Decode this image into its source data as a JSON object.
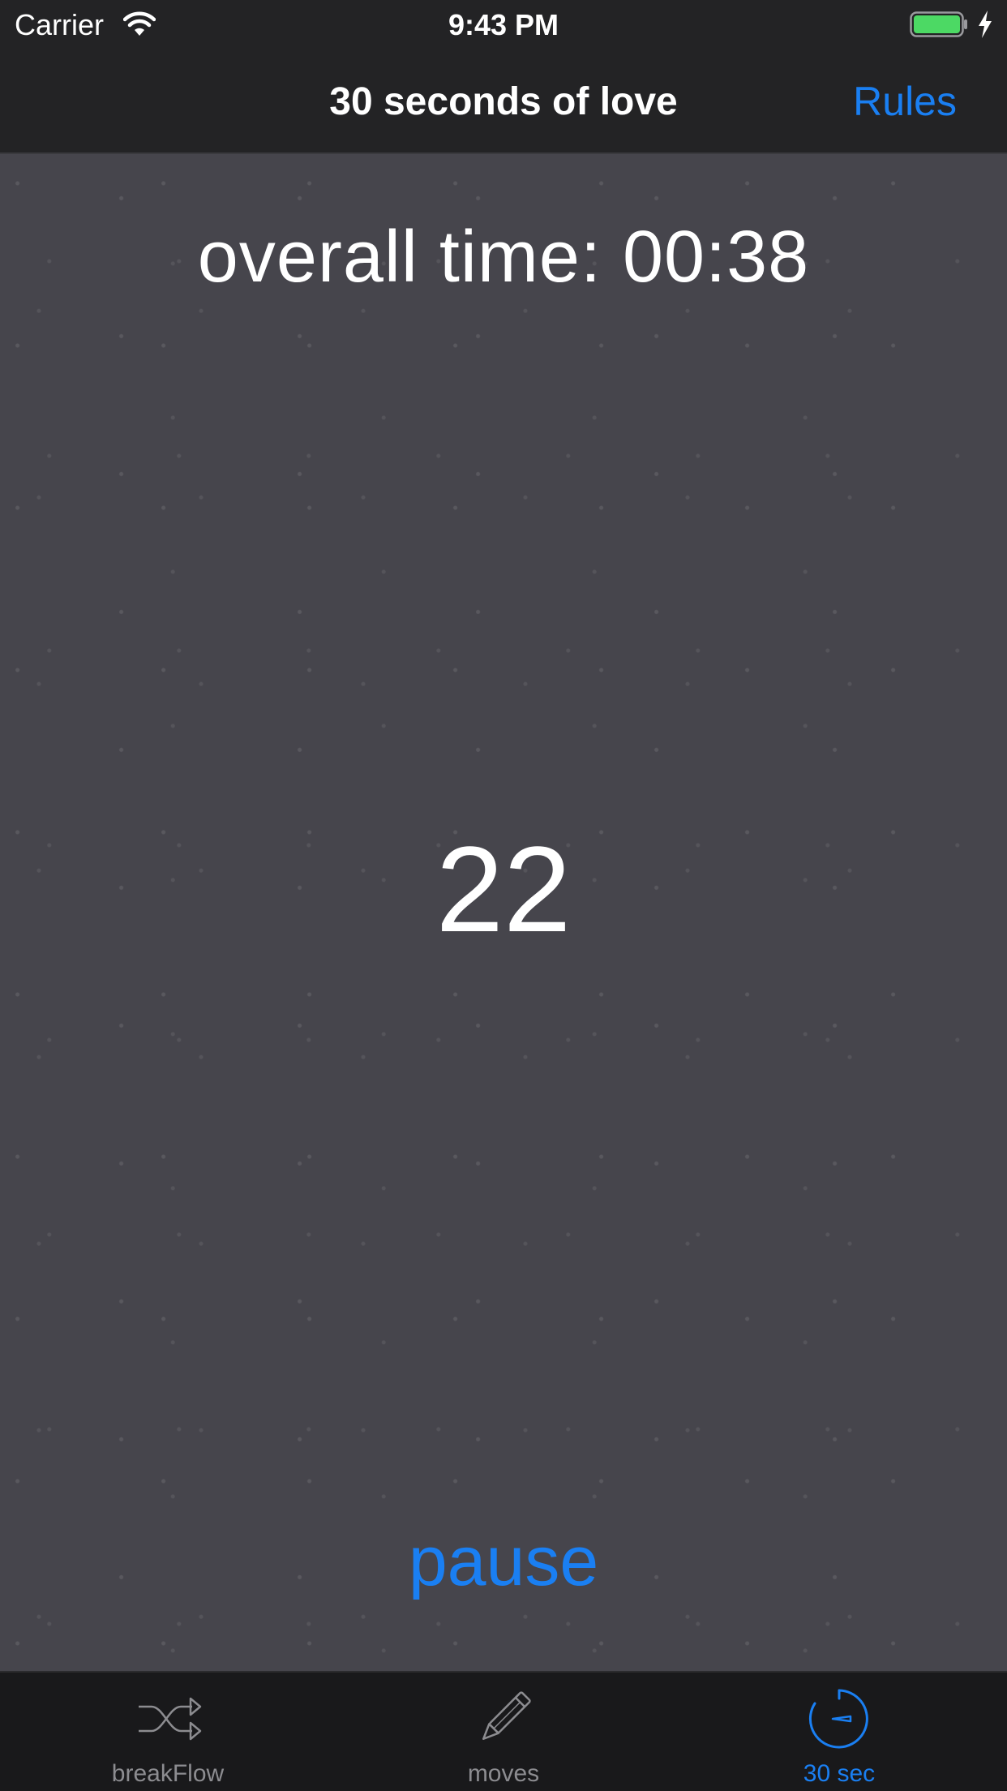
{
  "status_bar": {
    "carrier": "Carrier",
    "time": "9:43 PM",
    "battery_color": "#4cd964"
  },
  "nav_bar": {
    "title": "30 seconds of love",
    "rules_label": "Rules"
  },
  "main": {
    "overall_time": "overall time: 00:38",
    "countdown": "22",
    "pause_label": "pause"
  },
  "tab_bar": {
    "accent_color": "#1a7ff2",
    "tabs": [
      {
        "label": "breakFlow",
        "icon": "shuffle-icon",
        "active": false
      },
      {
        "label": "moves",
        "icon": "pencil-icon",
        "active": false
      },
      {
        "label": "30 sec",
        "icon": "timer-icon",
        "active": true
      }
    ]
  }
}
